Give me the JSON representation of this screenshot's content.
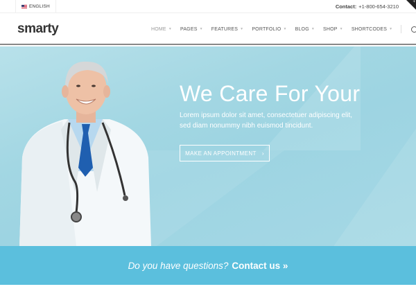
{
  "topbar": {
    "language": "ENGLISH",
    "contact_label": "Contact:",
    "phone": "+1-800-654-3210",
    "corner_icon": "+"
  },
  "header": {
    "logo": "smarty",
    "nav": [
      {
        "label": "HOME"
      },
      {
        "label": "PAGES"
      },
      {
        "label": "FEATURES"
      },
      {
        "label": "PORTFOLIO"
      },
      {
        "label": "BLOG"
      },
      {
        "label": "SHOP"
      },
      {
        "label": "SHORTCODES"
      }
    ],
    "search_icon": "search-icon"
  },
  "hero": {
    "title": "We Care For Your",
    "text": "Lorem ipsum dolor sit amet, consectetuer adipiscing elit, sed diam nonummy nibh euismod tincidunt.",
    "button": "MAKE AN APPOINTMENT",
    "button_arrow": "›"
  },
  "band": {
    "question": "Do you have questions?",
    "link": "Contact us »"
  },
  "colors": {
    "accent": "#5bbfdd",
    "hero_bg": "#a3d7e3"
  }
}
